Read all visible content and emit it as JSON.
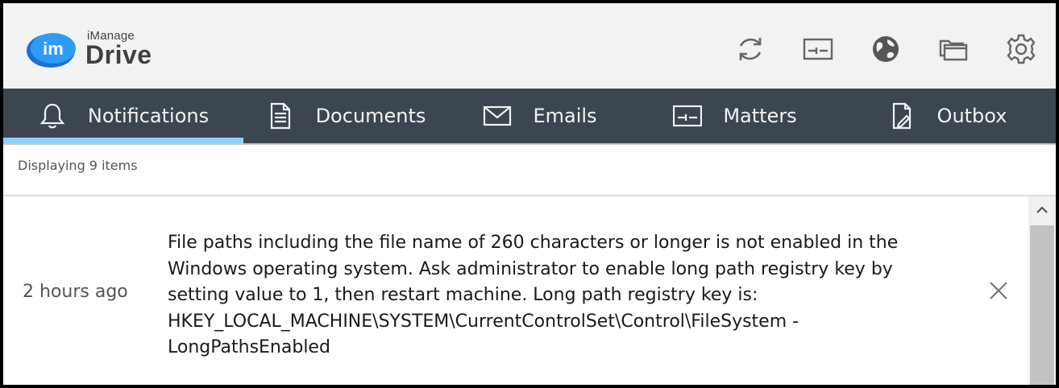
{
  "app": {
    "brand_small": "iManage",
    "brand_big": "Drive",
    "brand_mark": "im",
    "brand_color": "#1f8ef1"
  },
  "header_icons": [
    {
      "name": "sync-icon",
      "label": "sync"
    },
    {
      "name": "matters-panel-icon",
      "label": "matters"
    },
    {
      "name": "globe-icon",
      "label": "web"
    },
    {
      "name": "folders-icon",
      "label": "folders"
    },
    {
      "name": "settings-gear-icon",
      "label": "settings"
    }
  ],
  "tabs": [
    {
      "label": "Notifications",
      "icon": "bell-icon",
      "active": true
    },
    {
      "label": "Documents",
      "icon": "document-icon",
      "active": false
    },
    {
      "label": "Emails",
      "icon": "envelope-icon",
      "active": false
    },
    {
      "label": "Matters",
      "icon": "matter-icon",
      "active": false
    },
    {
      "label": "Outbox",
      "icon": "outbox-icon",
      "active": false
    }
  ],
  "colors": {
    "nav_bg": "#3c4650",
    "active_tab_indicator": "#8fd1f4",
    "header_bg": "#f2f2f2"
  },
  "list": {
    "count_text": "Displaying 9 items"
  },
  "notifications": [
    {
      "time": "2 hours ago",
      "lines": [
        "File paths including the file name of 260 characters or longer is not enabled in the",
        "Windows operating system. Ask administrator to enable long path registry key by",
        "setting value to 1, then restart machine. Long path registry key is:",
        "HKEY_LOCAL_MACHINE\\SYSTEM\\CurrentControlSet\\Control\\FileSystem -",
        "LongPathsEnabled"
      ],
      "dismiss_icon": "close-icon"
    }
  ]
}
